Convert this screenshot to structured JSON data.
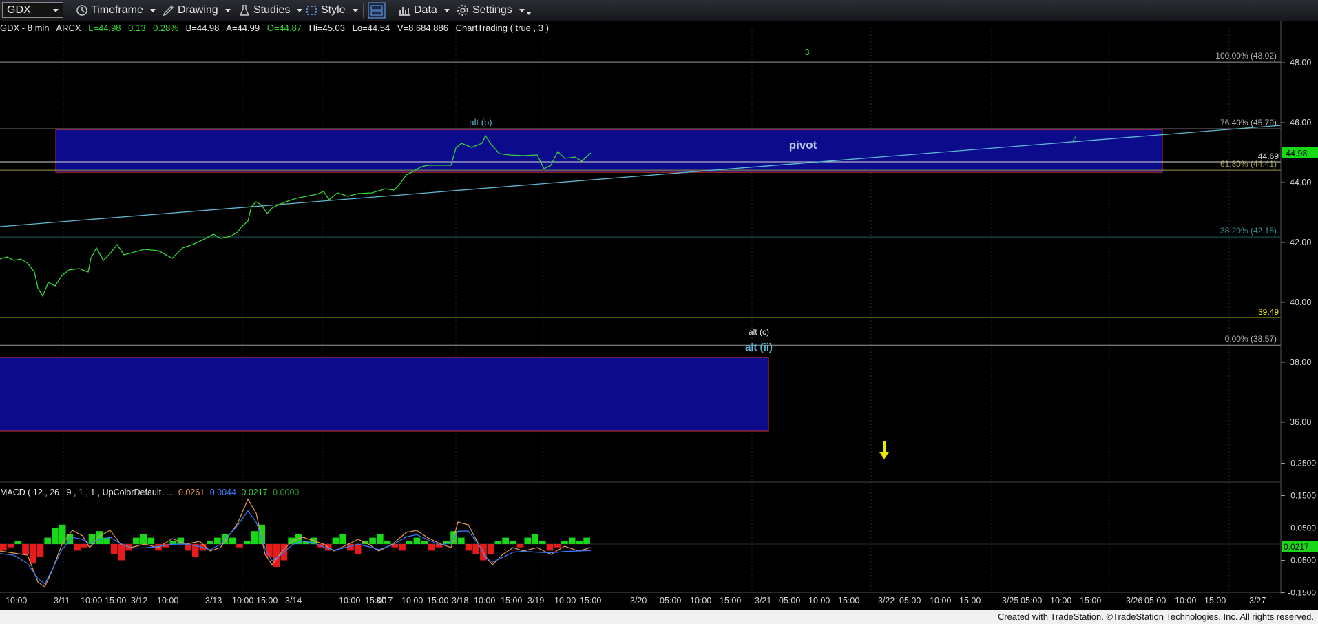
{
  "toolbar": {
    "symbol": "GDX",
    "timeframe": "Timeframe",
    "drawing": "Drawing",
    "studies": "Studies",
    "style": "Style",
    "data": "Data",
    "settings": "Settings"
  },
  "info_bar": {
    "symbol_desc": "GDX - 8 min",
    "exchange": "ARCX",
    "last": "L=44.98",
    "change": "0.13",
    "pct_change": "0.28%",
    "bid": "B=44.98",
    "ask": "A=44.99",
    "open": "O=44.87",
    "high": "Hi=45.03",
    "low": "Lo=44.54",
    "volume": "V=8,684,886",
    "study": "ChartTrading ( true , 3 )"
  },
  "price_axis": {
    "ticks": [
      "48.00",
      "46.00",
      "44.00",
      "42.00",
      "40.00",
      "38.00",
      "36.00"
    ],
    "current_price": "44.98"
  },
  "fib_levels": [
    {
      "label": "100.00% (48.02)",
      "value": 48.02
    },
    {
      "label": "76.40% (45.79)",
      "value": 45.79
    },
    {
      "label": "61.80% (44.41)",
      "value": 44.41
    },
    {
      "label": "38.20% (42.18)",
      "value": 42.18
    },
    {
      "label": "0.00% (38.57)",
      "value": 38.57
    }
  ],
  "price_lines": [
    {
      "label": "44.69",
      "value": 44.69
    },
    {
      "label": "39.49",
      "value": 39.49
    }
  ],
  "annotations": {
    "wave3": "3",
    "wave4": "4",
    "alt_b": "alt (b)",
    "pivot": "pivot",
    "alt_c": "alt (c)",
    "alt_ii": "alt (ii)"
  },
  "time_axis": [
    "10:00",
    "3/11",
    "10:00",
    "15:00",
    "3/12",
    "10:00",
    "3/13",
    "10:00",
    "15:00",
    "3/14",
    "10:00",
    "15:00",
    "3/17",
    "10:00",
    "15:00",
    "3/18",
    "10:00",
    "15:00",
    "3/19",
    "10:00",
    "15:00",
    "3/20",
    "05:00",
    "10:00",
    "15:00",
    "3/21",
    "05:00",
    "10:00",
    "15:00",
    "3/22",
    "05:00",
    "10:00",
    "15:00",
    "3/25",
    "05:00",
    "10:00",
    "15:00",
    "3/26",
    "05:00",
    "10:00",
    "15:00",
    "3/27"
  ],
  "macd": {
    "legend": "MACD ( 12 , 26 , 9 , 1 , 1 , UpColorDefault ,...",
    "macd_value": "0.0261",
    "signal_value": "0.0044",
    "hist_value": "0.0217",
    "zero_value": "0.0000",
    "axis_ticks": [
      "0.2500",
      "0.1500",
      "0.0500",
      "-0.0500",
      "-0.1500"
    ],
    "current": "0.0217"
  },
  "credit": "Created with TradeStation. ©TradeStation Technologies, Inc. All rights reserved.",
  "colors": {
    "price": "#35d635",
    "fib": "#9a9a9a",
    "zone_fill": "#0b0b8c",
    "zone_border": "#d03030",
    "trendline": "#5fb9d2",
    "yellow": "#e8e800",
    "macd_line": "#e89a5a",
    "signal_line": "#3a7cff",
    "hist_up": "#18d818",
    "hist_down": "#e61b1b"
  },
  "chart_data": {
    "type": "line",
    "price_series_daily_approx": [
      {
        "x": "3/10",
        "y": 41.6
      },
      {
        "x": "3/11",
        "y": 41.5
      },
      {
        "x": "3/12",
        "y": 41.6
      },
      {
        "x": "3/13",
        "y": 42.2
      },
      {
        "x": "3/14",
        "y": 43.6
      },
      {
        "x": "3/17",
        "y": 44.0
      },
      {
        "x": "3/18",
        "y": 45.2
      },
      {
        "x": "3/19",
        "y": 44.98
      }
    ]
  }
}
